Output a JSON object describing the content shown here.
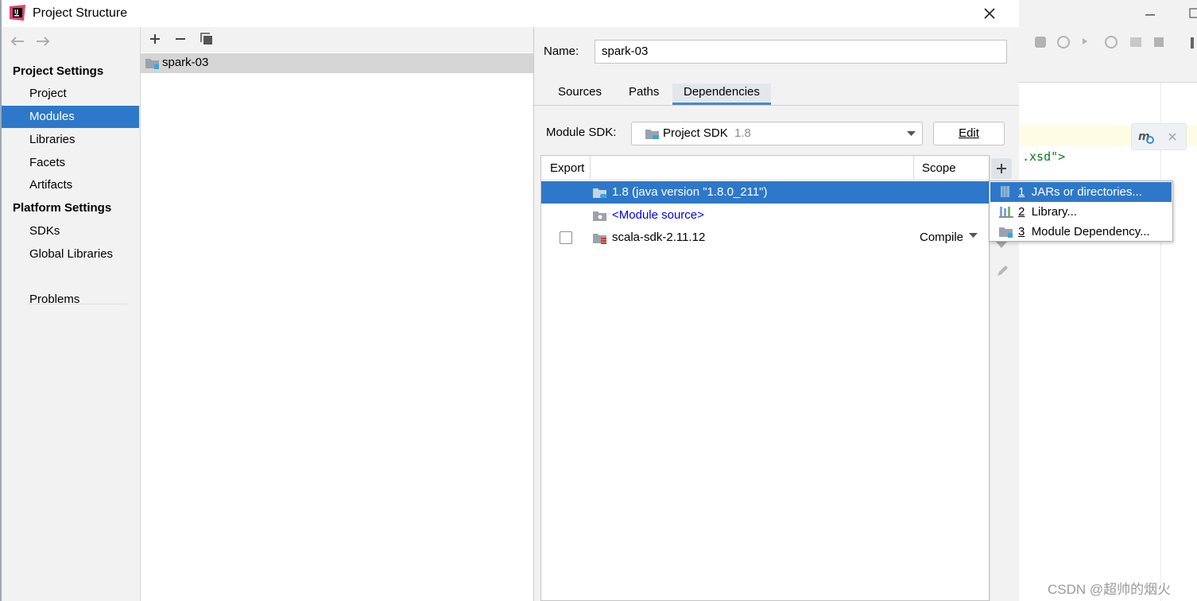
{
  "window": {
    "title": "Project Structure"
  },
  "nav": {
    "back_icon": "arrow-left-icon",
    "forward_icon": "arrow-right-icon"
  },
  "sidebar": {
    "project_settings_header": "Project Settings",
    "project_items": [
      "Project",
      "Modules",
      "Libraries",
      "Facets",
      "Artifacts"
    ],
    "selected_item": "Modules",
    "platform_settings_header": "Platform Settings",
    "platform_items": [
      "SDKs",
      "Global Libraries"
    ],
    "problems": "Problems"
  },
  "modules": {
    "items": [
      {
        "name": "spark-03"
      }
    ]
  },
  "details": {
    "name_label": "Name:",
    "name_value": "spark-03",
    "tabs": [
      "Sources",
      "Paths",
      "Dependencies"
    ],
    "active_tab": "Dependencies",
    "sdk_label": "Module SDK:",
    "sdk_value": "Project SDK",
    "sdk_version": "1.8",
    "edit_label": "Edit"
  },
  "dependencies": {
    "headers": {
      "export": "Export",
      "scope": "Scope"
    },
    "rows": [
      {
        "name": "1.8 (java version \"1.8.0_211\")",
        "scope": "",
        "selected": true
      },
      {
        "name": "<Module source>",
        "scope": ""
      },
      {
        "name": "scala-sdk-2.11.12",
        "scope": "Compile",
        "export": false
      }
    ]
  },
  "add_menu": {
    "items": [
      {
        "mnemonic": "1",
        "label": "JARs or directories...",
        "selected": true
      },
      {
        "mnemonic": "2",
        "label": "Library..."
      },
      {
        "mnemonic": "3",
        "label": "Module Dependency..."
      }
    ]
  },
  "background_editor": {
    "code": ".xsd\">"
  },
  "watermark": "CSDN @超帅的烟火",
  "colors": {
    "selection": "#2e78c9",
    "link": "#0000ee",
    "code_string": "#067d17"
  }
}
